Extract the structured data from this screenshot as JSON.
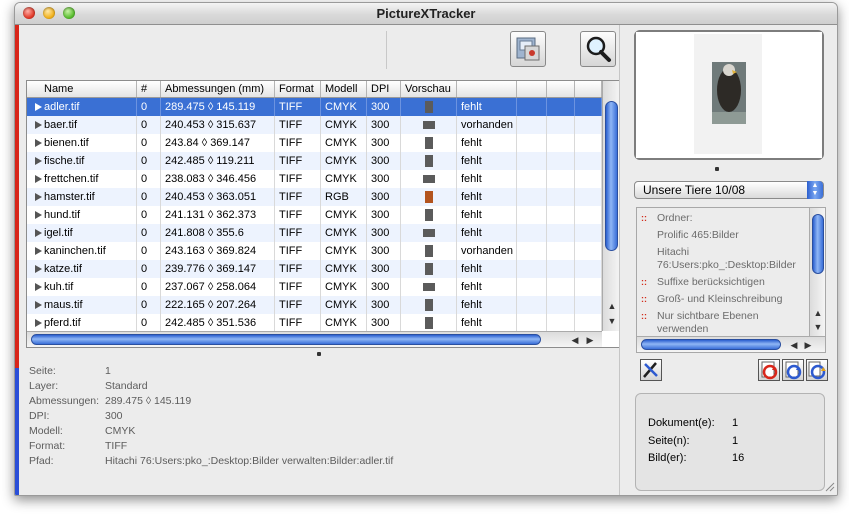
{
  "window": {
    "title": "PictureXTracker"
  },
  "table": {
    "headers": [
      "Name",
      "#",
      "Abmessungen (mm)",
      "Format",
      "Modell",
      "DPI",
      "Vorschau"
    ],
    "rows": [
      {
        "name": "adler.tif",
        "num": "0",
        "dims": "289.475 ◊ 145.119",
        "format": "TIFF",
        "model": "CMYK",
        "dpi": "300",
        "status": "fehlt"
      },
      {
        "name": "baer.tif",
        "num": "0",
        "dims": "240.453 ◊ 315.637",
        "format": "TIFF",
        "model": "CMYK",
        "dpi": "300",
        "status": "vorhanden"
      },
      {
        "name": "bienen.tif",
        "num": "0",
        "dims": "243.84 ◊ 369.147",
        "format": "TIFF",
        "model": "CMYK",
        "dpi": "300",
        "status": "fehlt"
      },
      {
        "name": "fische.tif",
        "num": "0",
        "dims": "242.485 ◊ 119.211",
        "format": "TIFF",
        "model": "CMYK",
        "dpi": "300",
        "status": "fehlt"
      },
      {
        "name": "frettchen.tif",
        "num": "0",
        "dims": "238.083 ◊ 346.456",
        "format": "TIFF",
        "model": "CMYK",
        "dpi": "300",
        "status": "fehlt"
      },
      {
        "name": "hamster.tif",
        "num": "0",
        "dims": "240.453 ◊ 363.051",
        "format": "TIFF",
        "model": "RGB",
        "dpi": "300",
        "status": "fehlt"
      },
      {
        "name": "hund.tif",
        "num": "0",
        "dims": "241.131 ◊ 362.373",
        "format": "TIFF",
        "model": "CMYK",
        "dpi": "300",
        "status": "fehlt"
      },
      {
        "name": "igel.tif",
        "num": "0",
        "dims": "241.808 ◊ 355.6",
        "format": "TIFF",
        "model": "CMYK",
        "dpi": "300",
        "status": "fehlt"
      },
      {
        "name": "kaninchen.tif",
        "num": "0",
        "dims": "243.163 ◊ 369.824",
        "format": "TIFF",
        "model": "CMYK",
        "dpi": "300",
        "status": "vorhanden"
      },
      {
        "name": "katze.tif",
        "num": "0",
        "dims": "239.776 ◊ 369.147",
        "format": "TIFF",
        "model": "CMYK",
        "dpi": "300",
        "status": "fehlt"
      },
      {
        "name": "kuh.tif",
        "num": "0",
        "dims": "237.067 ◊ 258.064",
        "format": "TIFF",
        "model": "CMYK",
        "dpi": "300",
        "status": "fehlt"
      },
      {
        "name": "maus.tif",
        "num": "0",
        "dims": "222.165 ◊ 207.264",
        "format": "TIFF",
        "model": "CMYK",
        "dpi": "300",
        "status": "fehlt"
      },
      {
        "name": "pferd.tif",
        "num": "0",
        "dims": "242.485 ◊ 351.536",
        "format": "TIFF",
        "model": "CMYK",
        "dpi": "300",
        "status": "fehlt"
      }
    ]
  },
  "info": {
    "page_label": "Seite:",
    "page_value": "1",
    "layer_label": "Layer:",
    "layer_value": "Standard",
    "dims_label": "Abmessungen:",
    "dims_value": "289.475 ◊ 145.119",
    "dpi_label": "DPI:",
    "dpi_value": "300",
    "model_label": "Modell:",
    "model_value": "CMYK",
    "format_label": "Format:",
    "format_value": "TIFF",
    "path_label": "Pfad:",
    "path_value": "Hitachi 76:Users:pko_:Desktop:Bilder verwalten:Bilder:adler.tif"
  },
  "collection": {
    "selected": "Unsere Tiere 10/08"
  },
  "options": {
    "folder_label": "Ordner:",
    "folders": [
      "Prolific 465:Bilder",
      "Hitachi 76:Users:pko_:Desktop:Bilder"
    ],
    "suffix": "Suffixe berücksichtigen",
    "case": "Groß- und Kleinschreibung",
    "visible_layers": "Nur sichtbare Ebenen verwenden"
  },
  "stats": {
    "documents_label": "Dokument(e):",
    "documents_value": "1",
    "pages_label": "Seite(n):",
    "pages_value": "1",
    "images_label": "Bild(er):",
    "images_value": "16"
  },
  "colors": {
    "selection": "#3a70d4",
    "accent_red": "#d8261a",
    "scroll_blue": "#3a6fd8"
  }
}
